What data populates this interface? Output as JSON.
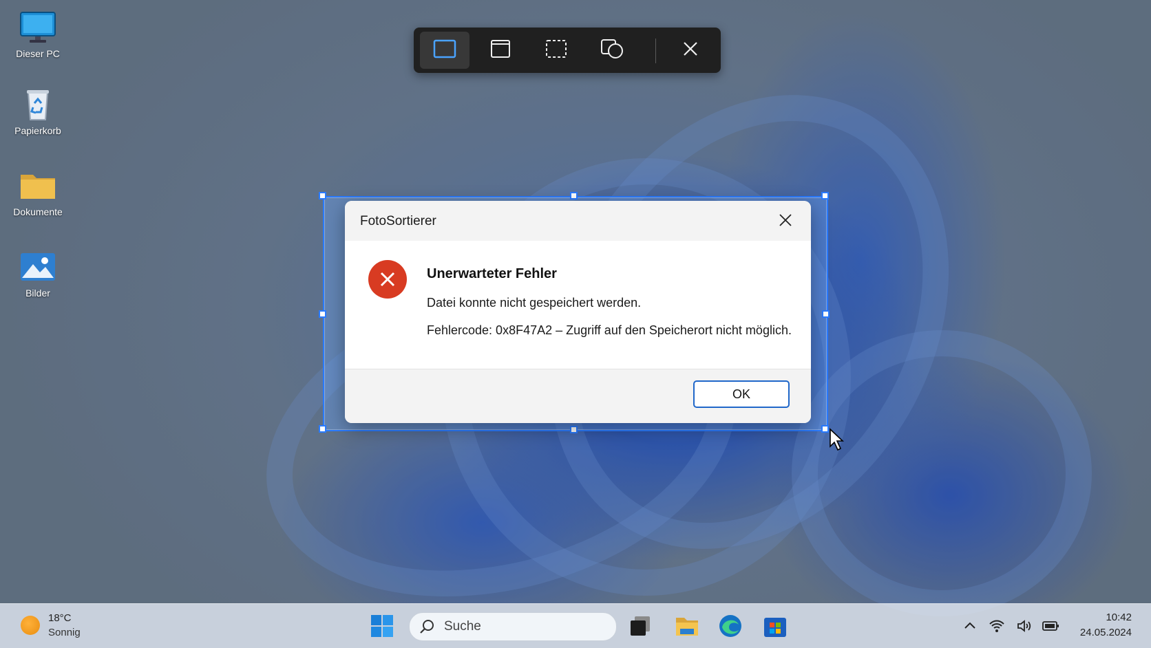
{
  "desktop": {
    "icons": [
      {
        "label": "Dieser PC",
        "icon": "monitor-icon"
      },
      {
        "label": "Papierkorb",
        "icon": "recycle-bin-icon"
      },
      {
        "label": "Dokumente",
        "icon": "folder-icon"
      },
      {
        "label": "Bilder",
        "icon": "pictures-icon"
      }
    ]
  },
  "snip_toolbar": {
    "modes": [
      "rectangle-mode-icon",
      "window-mode-icon",
      "freeform-mode-icon",
      "shape-mode-icon"
    ],
    "active_mode": "rectangle-mode-icon",
    "close_icon": "close-icon"
  },
  "dialog": {
    "title": "FotoSortierer",
    "heading": "Unerwarteter Fehler",
    "message": "Datei konnte nicht gespeichert werden.",
    "detail": "Fehlercode: 0x8F47A2 – Zugriff auf den Speicherort nicht möglich.",
    "ok_label": "OK",
    "icon": "error-icon"
  },
  "taskbar": {
    "weather": {
      "temp": "18°C",
      "desc": "Sonnig"
    },
    "search_placeholder": "Suche",
    "apps": [
      "start-icon",
      "task-view-icon",
      "file-explorer-icon",
      "edge-icon",
      "store-icon"
    ],
    "tray": [
      "chevron-up-icon",
      "wifi-icon",
      "volume-icon",
      "battery-icon"
    ],
    "clock": {
      "time": "10:42",
      "date": "24.05.2024"
    }
  },
  "colors": {
    "accent": "#2a7bff",
    "error": "#d83b22",
    "toolbar_bg": "#202020"
  }
}
